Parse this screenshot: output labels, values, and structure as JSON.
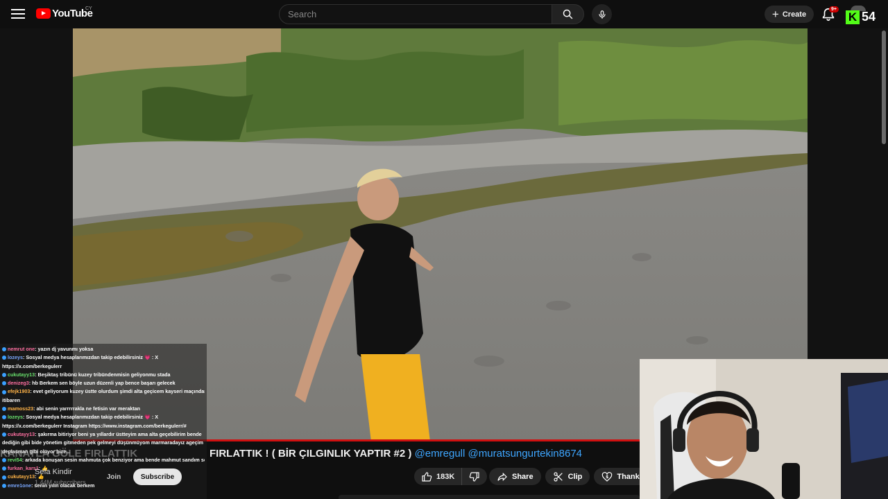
{
  "header": {
    "logo_text": "YouTube",
    "country_code": "CY",
    "search_placeholder": "Search",
    "create_label": "Create",
    "notification_count": "9+",
    "kick_count": "54"
  },
  "video": {
    "progress_fraction": 0.87
  },
  "chat": {
    "messages": [
      {
        "user": "nemrut one",
        "text": ": yazın dj yavunmı yoksa"
      },
      {
        "user": "lozeys",
        "text": ": Sosyal medya hesaplarımızdan takip edebilirsiniz 💗 : X"
      },
      {
        "user": "",
        "text": "https://x.com/berkegulerr"
      },
      {
        "user": "cukutayy13",
        "text": ": Beşiktaş tribünü kuzey tribündenmisin geliyonmu stada"
      },
      {
        "user": "denizeg3",
        "text": ": hb Berkem sen böyle uzun düzenli yap bence başarı gelecek"
      },
      {
        "user": "efejk1903",
        "text": ": evet geliyorum kuzey üstte olurdum şimdi alta geçicem kayseri maçından"
      },
      {
        "user": "",
        "text": "itibaren"
      },
      {
        "user": "mamoss23",
        "text": ": abi senin yarrrrrakla ne fetisin var meraktan"
      },
      {
        "user": "lozeys",
        "text": ": Sosyal medya hesaplarımızdan takip edebilirsiniz 💗 : X"
      },
      {
        "user": "",
        "text": "https://x.com/berkegulerr Instagram https://www.instagram.com/berkegulerr/#"
      },
      {
        "user": "cukutayy13",
        "text": ": şakırma bitiriyor beni ya yıllardır üstteyim ama alta geçebilirim bende"
      },
      {
        "user": "",
        "text": "dediğin gibi bide yönetim gitmeden pek gelmeyi düşünmüyom marmaradayız ageçim"
      },
      {
        "user": "",
        "text": "deplasman gibi oluyor bize..."
      },
      {
        "user": "revi54",
        "text": ": arkada konuşan sesin mahmuta çok benziyor ama bende mahmut sandım seni"
      },
      {
        "user": "furkan_kars1",
        "text": ": 👍"
      },
      {
        "user": "cukutayy13",
        "text": ": 👍"
      },
      {
        "user": "emre1one",
        "text": ": senin yılın olacak berkem"
      }
    ]
  },
  "title": {
    "text": "FIRLATTIK ! ( BİR ÇILGINLIK YAPTIR #2 )",
    "shadow_text": "KANATLA GÖLE FIRLATTIK",
    "mention1": "@emregull",
    "mention2": "@muratsungurtekin8674"
  },
  "channel": {
    "name": "Sefa Kindir",
    "subscribers": "1.44M subscribers",
    "join_label": "Join",
    "subscribe_label": "Subscribe"
  },
  "actions": {
    "like_count": "183K",
    "share_label": "Share",
    "clip_label": "Clip",
    "thanks_label": "Thanks"
  },
  "colors": {
    "accent": "#ff0000",
    "progress": "#d01010",
    "link": "#3ea6ff",
    "kick": "#53fc18"
  }
}
